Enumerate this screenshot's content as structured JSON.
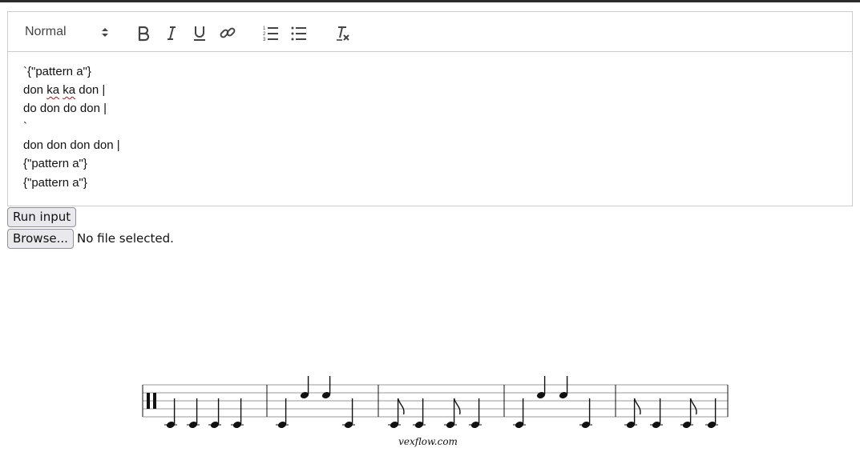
{
  "toolbar": {
    "header_select": {
      "selected": "Normal"
    },
    "buttons": [
      {
        "name": "bold",
        "icon": "bold-icon"
      },
      {
        "name": "italic",
        "icon": "italic-icon"
      },
      {
        "name": "underline",
        "icon": "underline-icon"
      },
      {
        "name": "link",
        "icon": "link-icon"
      },
      {
        "name": "ordered-list",
        "icon": "ordered-list-icon"
      },
      {
        "name": "bullet-list",
        "icon": "bullet-list-icon"
      },
      {
        "name": "clear-format",
        "icon": "clear-format-icon"
      }
    ]
  },
  "editor": {
    "lines": [
      {
        "segments": [
          "`{\"pattern a\"}"
        ]
      },
      {
        "segments": [
          "don ",
          "ka",
          " ",
          "ka",
          " don |"
        ],
        "misspelled": [
          1,
          3
        ]
      },
      {
        "segments": [
          "do don do don |"
        ]
      },
      {
        "segments": [
          "`"
        ]
      },
      {
        "segments": [
          "don don don don |"
        ]
      },
      {
        "segments": [
          "{\"pattern a\"}"
        ]
      },
      {
        "segments": [
          "{\"pattern a\"}"
        ]
      }
    ]
  },
  "actions": {
    "run_label": "Run input",
    "browse_label": "Browse...",
    "file_status": "No file selected."
  },
  "score": {
    "credit": "vexflow.com",
    "measures": [
      {
        "notes": [
          {
            "pos": "low",
            "dur": "q"
          },
          {
            "pos": "low",
            "dur": "q"
          },
          {
            "pos": "low",
            "dur": "q"
          },
          {
            "pos": "low",
            "dur": "q"
          }
        ]
      },
      {
        "notes": [
          {
            "pos": "low",
            "dur": "q"
          },
          {
            "pos": "high",
            "dur": "q"
          },
          {
            "pos": "high",
            "dur": "q"
          },
          {
            "pos": "low",
            "dur": "q"
          }
        ]
      },
      {
        "notes": [
          {
            "pos": "low",
            "dur": "8"
          },
          {
            "pos": "low",
            "dur": "q"
          },
          {
            "pos": "low",
            "dur": "8"
          },
          {
            "pos": "low",
            "dur": "q"
          }
        ]
      },
      {
        "notes": [
          {
            "pos": "low",
            "dur": "q"
          },
          {
            "pos": "high",
            "dur": "q"
          },
          {
            "pos": "high",
            "dur": "q"
          },
          {
            "pos": "low",
            "dur": "q"
          }
        ]
      },
      {
        "notes": [
          {
            "pos": "low",
            "dur": "8"
          },
          {
            "pos": "low",
            "dur": "q"
          },
          {
            "pos": "low",
            "dur": "8"
          },
          {
            "pos": "low",
            "dur": "q"
          }
        ]
      }
    ]
  }
}
